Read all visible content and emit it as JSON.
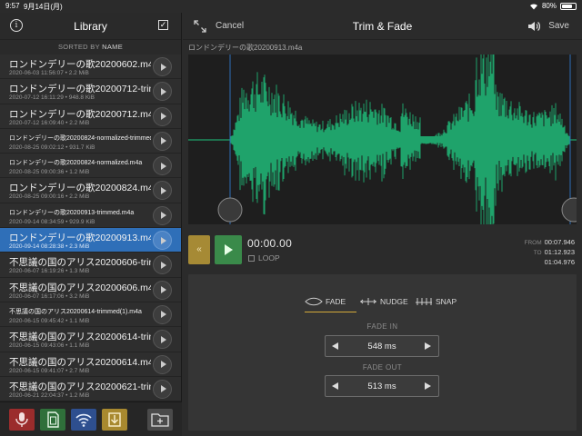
{
  "status": {
    "time": "9:57",
    "date": "9月14日(月)",
    "battery": "80%",
    "battery_level": 0.8
  },
  "sidebar": {
    "title": "Library",
    "sort_prefix": "SORTED BY",
    "sort_key": "NAME",
    "files": [
      {
        "name": "ロンドンデリーの歌20200602.m4a",
        "meta": "2020-06-03 11:56:07 • 2.2 MiB",
        "small": false,
        "active": false
      },
      {
        "name": "ロンドンデリーの歌20200712-trimmed.m4a",
        "meta": "2020-07-12 16:11:29 • 948.8 KiB",
        "small": false,
        "active": false
      },
      {
        "name": "ロンドンデリーの歌20200712.m4a",
        "meta": "2020-07-12 16:09:40 • 2.2 MiB",
        "small": false,
        "active": false
      },
      {
        "name": "ロンドンデリーの歌20200824-normalized-trimmed.m4a",
        "meta": "2020-08-25 09:02:12 • 931.7 KiB",
        "small": true,
        "active": false
      },
      {
        "name": "ロンドンデリーの歌20200824-normalized.m4a",
        "meta": "2020-08-25 09:00:36 • 1.2 MiB",
        "small": true,
        "active": false
      },
      {
        "name": "ロンドンデリーの歌20200824.m4a",
        "meta": "2020-08-25 09:00:16 • 2.2 MiB",
        "small": false,
        "active": false
      },
      {
        "name": "ロンドンデリーの歌20200913-trimmed.m4a",
        "meta": "2020-09-14 08:34:59 • 929.9 KiB",
        "small": true,
        "active": false
      },
      {
        "name": "ロンドンデリーの歌20200913.m4a",
        "meta": "2020-09-14 08:28:38 • 2.3 MiB",
        "small": false,
        "active": true
      },
      {
        "name": "不思議の国のアリス20200606-trimmed.m4a",
        "meta": "2020-06-07 16:19:26 • 1.3 MiB",
        "small": false,
        "active": false
      },
      {
        "name": "不思議の国のアリス20200606.m4a",
        "meta": "2020-06-07 16:17:06 • 3.2 MiB",
        "small": false,
        "active": false
      },
      {
        "name": "不思議の国のアリス20200614-trimmed(1).m4a",
        "meta": "2020-06-15 09:45:42 • 1.1 MiB",
        "small": true,
        "active": false
      },
      {
        "name": "不思議の国のアリス20200614-trimmed.m4a",
        "meta": "2020-06-15 09:43:06 • 1.1 MiB",
        "small": false,
        "active": false
      },
      {
        "name": "不思議の国のアリス20200614.m4a",
        "meta": "2020-06-15 09:41:07 • 2.7 MiB",
        "small": false,
        "active": false
      },
      {
        "name": "不思議の国のアリス20200621-trimmed.m4a",
        "meta": "2020-06-21 22:04:37 • 1.2 MiB",
        "small": false,
        "active": false
      }
    ],
    "toolbar": [
      {
        "name": "record-button",
        "icon": "microphone-icon",
        "color": "#9b2c2c"
      },
      {
        "name": "sd-card-button",
        "icon": "sd-card-icon",
        "color": "#2f6f3a"
      },
      {
        "name": "wifi-button",
        "icon": "wifi-icon",
        "color": "#2e4f8f"
      },
      {
        "name": "import-button",
        "icon": "download-icon",
        "color": "#a8892f"
      },
      {
        "name": "new-folder-button",
        "icon": "folder-add-icon",
        "color": "#4a4a4a"
      }
    ]
  },
  "editor": {
    "title": "Trim & Fade",
    "cancel_label": "Cancel",
    "save_label": "Save",
    "filename": "ロンドンデリーの歌20200913.m4a",
    "waveform_color": "#1fa36b",
    "rewind_label": "«",
    "current_time": "00:00.00",
    "loop_label": "LOOP",
    "from_label": "FROM",
    "from_value": "00:07.946",
    "to_label": "TO",
    "to_value": "01:12.923",
    "duration_value": "01:04.976",
    "tabs": {
      "fade": "FADE",
      "nudge": "NUDGE",
      "snap": "SNAP"
    },
    "fade_in_label": "FADE IN",
    "fade_in_value": "548 ms",
    "fade_out_label": "FADE OUT",
    "fade_out_value": "513 ms"
  }
}
